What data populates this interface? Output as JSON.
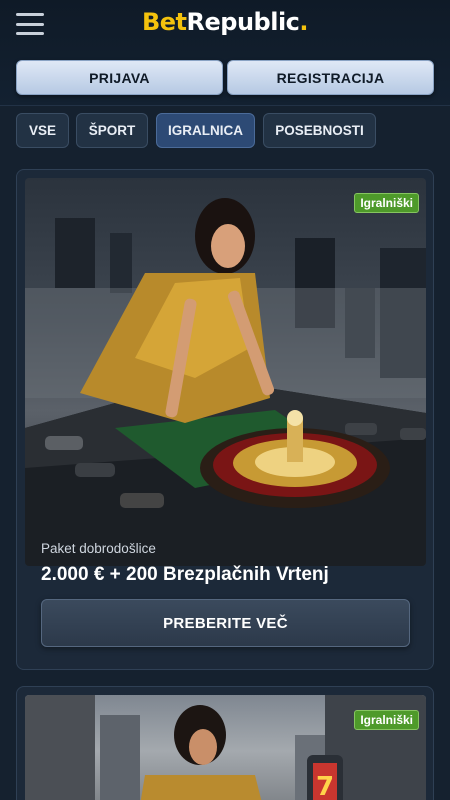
{
  "header": {
    "menu_icon": "hamburger-menu-icon",
    "logo": {
      "part1": "Bet",
      "part2": "Republic",
      "dot": "."
    },
    "login_label": "PRIJAVA",
    "register_label": "REGISTRACIJA"
  },
  "tabs": [
    {
      "label": "VSE",
      "active": false
    },
    {
      "label": "ŠPORT",
      "active": false
    },
    {
      "label": "IGRALNICA",
      "active": true
    },
    {
      "label": "POSEBNOSTI",
      "active": false
    }
  ],
  "promos": [
    {
      "badge": "Igralniški",
      "subtitle": "Paket dobrodošlice",
      "title": "2.000 € + 200 Brezplačnih Vrtenj",
      "cta": "PREBERITE VEČ"
    },
    {
      "badge": "Igralniški"
    }
  ],
  "colors": {
    "background": "#15212f",
    "brand_yellow": "#f4c20d",
    "badge_green": "#4e9a2a",
    "active_tab": "#2d4a75"
  }
}
